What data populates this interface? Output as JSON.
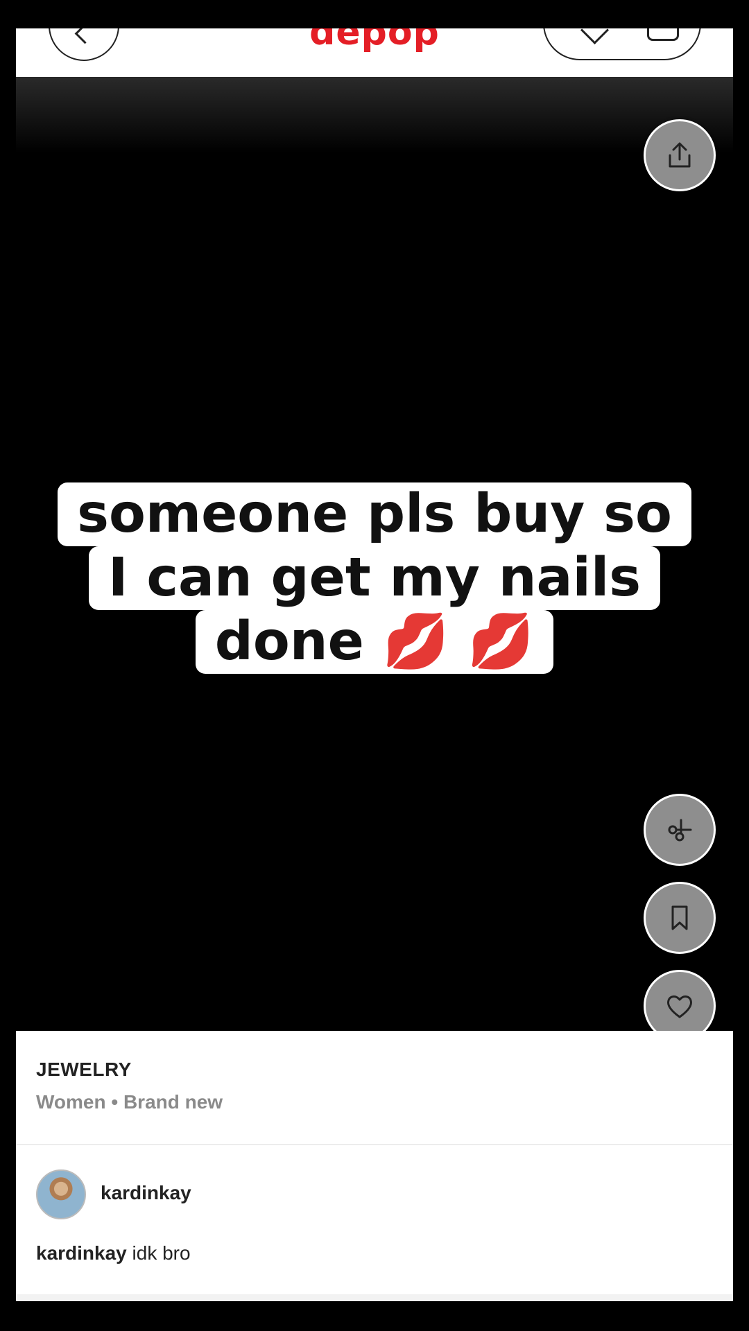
{
  "header": {
    "logo_text": "depop",
    "back_icon": "chevron-left-icon",
    "pill_icons": [
      "tag-icon",
      "bag-icon"
    ]
  },
  "media": {
    "caption_lines": [
      "someone pls buy so",
      "I can get my nails",
      "done"
    ],
    "caption_emoji": "💋 💋",
    "actions": [
      {
        "name": "share",
        "icon": "share-icon"
      },
      {
        "name": "cut",
        "icon": "scissors-icon"
      },
      {
        "name": "save",
        "icon": "bookmark-icon"
      },
      {
        "name": "like",
        "icon": "heart-icon"
      }
    ]
  },
  "product": {
    "category": "JEWELRY",
    "meta": "Women • Brand new"
  },
  "seller": {
    "username": "kardinkay",
    "description_user": "kardinkay",
    "description_text": "idk bro"
  },
  "colors": {
    "brand": "#e41e26",
    "fab": "#8e8e8e"
  }
}
